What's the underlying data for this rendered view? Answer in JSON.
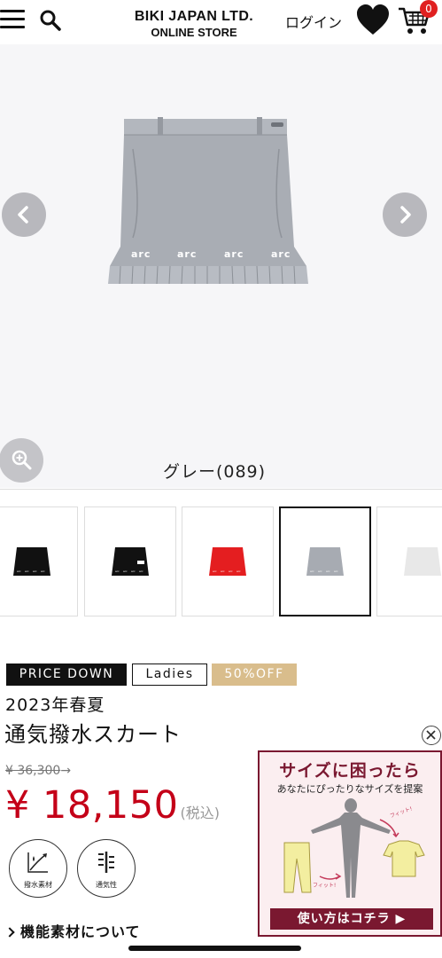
{
  "header": {
    "logo_line1": "BIKI JAPAN LTD.",
    "logo_line2": "ONLINE STORE",
    "login_label": "ログイン",
    "cart_count": "0"
  },
  "gallery": {
    "color_name": "グレー(089)",
    "skirt_print": "arc"
  },
  "thumbnails": [
    {
      "color": "#111111",
      "selected": false
    },
    {
      "color": "#111111",
      "selected": false
    },
    {
      "color": "#e41e20",
      "selected": false
    },
    {
      "color": "#a7abb2",
      "selected": true
    },
    {
      "color": "#e8e8e8",
      "selected": false
    }
  ],
  "tags": {
    "price_down": "PRICE DOWN",
    "ladies": "Ladies",
    "off": "50%OFF"
  },
  "product": {
    "season": "2023年春夏",
    "title": "通気撥水スカート",
    "old_price": "¥ 36,300",
    "old_price_arrow": "→",
    "new_price": "¥ 18,150",
    "tax_label": "(税込)"
  },
  "features": [
    {
      "label": "撥水素材",
      "icon": "water-repellent-icon"
    },
    {
      "label": "通気性",
      "icon": "breathable-icon"
    }
  ],
  "function_link": "機能素材について",
  "banner": {
    "title": "サイズに困ったら",
    "subtitle": "あなたにぴったりなサイズを提案",
    "fit_label": "フィット!",
    "cta": "使い方はコチラ ▶"
  },
  "colors": {
    "price_red": "#c40018",
    "tag_gold": "#d9bd8c",
    "banner_maroon": "#7a1830",
    "badge_red": "#e02020"
  }
}
